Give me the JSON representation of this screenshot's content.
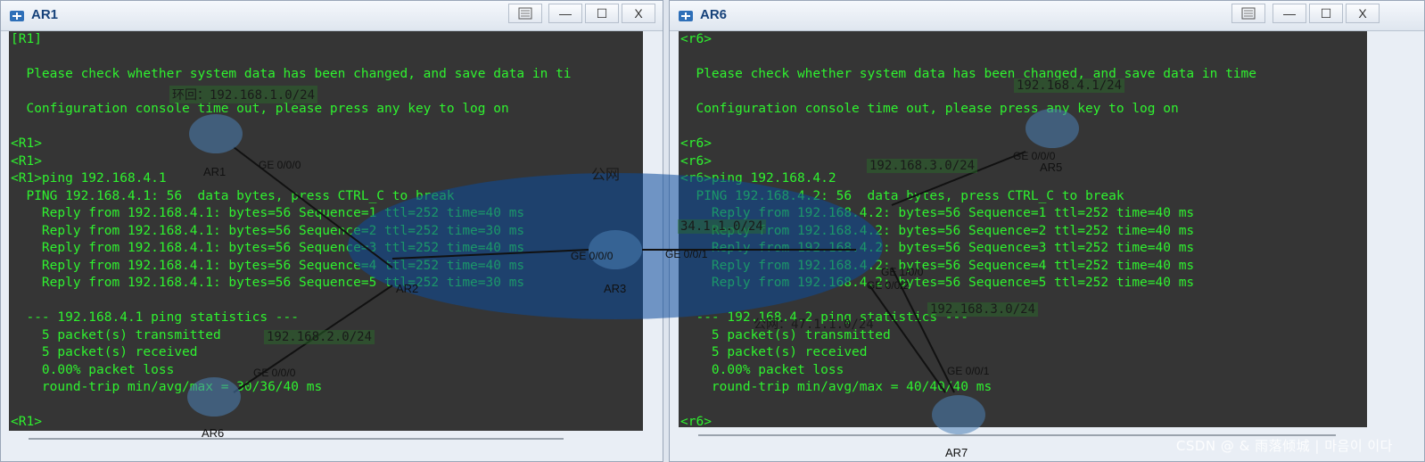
{
  "windows": [
    {
      "id": "ar1",
      "title": "AR1",
      "lines": [
        "[R1]",
        "",
        "  Please check whether system data has been changed, and save data in ti",
        "",
        "  Configuration console time out, please press any key to log on",
        "",
        "<R1>",
        "<R1>",
        "<R1>ping 192.168.4.1",
        "  PING 192.168.4.1: 56  data bytes, press CTRL_C to break",
        "    Reply from 192.168.4.1: bytes=56 Sequence=1 ttl=252 time=40 ms",
        "    Reply from 192.168.4.1: bytes=56 Sequence=2 ttl=252 time=30 ms",
        "    Reply from 192.168.4.1: bytes=56 Sequence=3 ttl=252 time=40 ms",
        "    Reply from 192.168.4.1: bytes=56 Sequence=4 ttl=252 time=40 ms",
        "    Reply from 192.168.4.1: bytes=56 Sequence=5 ttl=252 time=30 ms",
        "",
        "  --- 192.168.4.1 ping statistics ---",
        "    5 packet(s) transmitted",
        "    5 packet(s) received",
        "    0.00% packet loss",
        "    round-trip min/avg/max = 30/36/40 ms",
        "",
        "<R1>"
      ]
    },
    {
      "id": "ar6",
      "title": "AR6",
      "lines": [
        "<r6>",
        "",
        "  Please check whether system data has been changed, and save data in time",
        "",
        "  Configuration console time out, please press any key to log on",
        "",
        "<r6>",
        "<r6>",
        "<r6>ping 192.168.4.2",
        "  PING 192.168.4.2: 56  data bytes, press CTRL_C to break",
        "    Reply from 192.168.4.2: bytes=56 Sequence=1 ttl=252 time=40 ms",
        "    Reply from 192.168.4.2: bytes=56 Sequence=2 ttl=252 time=40 ms",
        "    Reply from 192.168.4.2: bytes=56 Sequence=3 ttl=252 time=40 ms",
        "    Reply from 192.168.4.2: bytes=56 Sequence=4 ttl=252 time=40 ms",
        "    Reply from 192.168.4.2: bytes=56 Sequence=5 ttl=252 time=40 ms",
        "",
        "  --- 192.168.4.2 ping statistics ---",
        "    5 packet(s) transmitted",
        "    5 packet(s) received",
        "    0.00% packet loss",
        "    round-trip min/avg/max = 40/40/40 ms",
        "",
        "<r6>"
      ]
    }
  ],
  "titlebar_buttons": {
    "extra": "",
    "minimize": "—",
    "maximize": "☐",
    "close": "X"
  },
  "topology": {
    "networks": {
      "loopback": "环回：192.168.1.0/24",
      "lan_ar5": "192.168.4.1/24",
      "net_168_3_top": "192.168.3.0/24",
      "net_168_2": "192.168.2.0/24",
      "net_168_3_bottom": "192.168.3.0/24",
      "public": "公网",
      "public_addr": "34.1.1.0/24",
      "public_bottom": "公网：47.1.1.0/24"
    },
    "devices": {
      "ar1": "AR1",
      "ar2": "AR2",
      "ar3": "AR3",
      "ar5": "AR5",
      "ar6": "AR6",
      "ar7": "AR7"
    },
    "ports": {
      "ar1_ge000": "GE 0/0/0",
      "ar5_ge000": "GE 0/0/0",
      "ar3_ge000": "GE 0/0/0",
      "ar3_ge001": "GE 0/0/1",
      "ar6_ge000": "GE 0/0/0",
      "ar2_ge002": "GE 0/0/2",
      "ar7_ge001": "GE 0/0/1",
      "ar4_ge100": "GE 1/0/0",
      "ar4_ge002": "GE 0/0/2"
    }
  },
  "watermark": "CSDN @ & 雨落倾城 | 마음이 이다",
  "colors": {
    "terminal_bg": "#353535",
    "terminal_text": "#2ff22f",
    "title_text": "#16427a",
    "public_cloud": "#0b4a9a"
  },
  "icons": {
    "window_icon": "ensp-router-icon"
  }
}
